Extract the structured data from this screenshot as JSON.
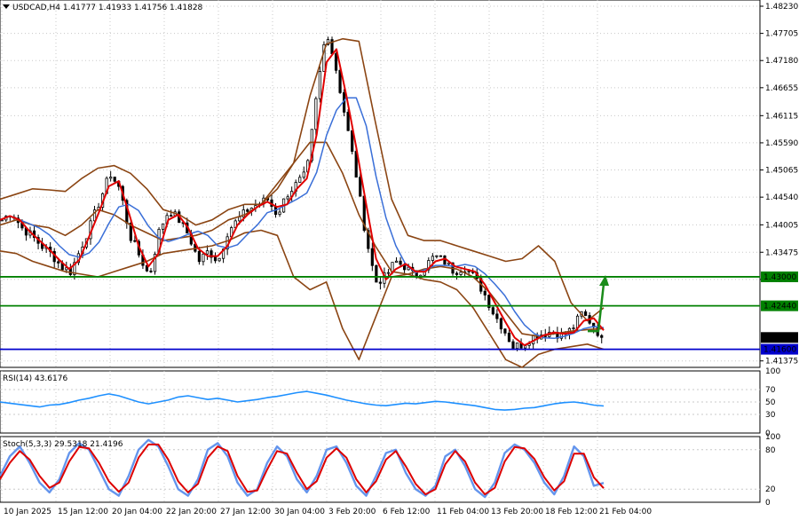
{
  "header": {
    "symbol": "USDCAD,H4",
    "ohlc": "1.41777 1.41933 1.41756 1.41828",
    "menu_icon": "triangle-down-icon"
  },
  "colors": {
    "background": "#ffffff",
    "grid": "#c8c8c8",
    "candle": "#000000",
    "bollinger": "#8b4513",
    "ma_fast": "#e00000",
    "ma_slow": "#3a6fd8",
    "level_green": "#008000",
    "level_blue": "#0000cc",
    "arrow": "#1a8c1a",
    "rsi": "#1e90ff",
    "stoch_main": "#6495ed",
    "stoch_signal": "#dd0000"
  },
  "chart_data": [
    {
      "type": "candlestick",
      "title": "USDCAD,H4",
      "ylim": [
        1.4125,
        1.4835
      ],
      "y_ticks": [
        "1.48230",
        "1.47705",
        "1.47180",
        "1.46655",
        "1.46115",
        "1.45590",
        "1.45065",
        "1.44540",
        "1.44005",
        "1.43475",
        "1.42950",
        "1.41375"
      ],
      "x_ticks": [
        "10 Jan 2025",
        "15 Jan 12:00",
        "20 Jan 04:00",
        "22 Jan 20:00",
        "27 Jan 12:00",
        "30 Jan 04:00",
        "3 Feb 20:00",
        "6 Feb 12:00",
        "11 Feb 04:00",
        "13 Feb 20:00",
        "18 Feb 12:00",
        "21 Feb 04:00"
      ],
      "close_path": [
        1.441,
        1.4425,
        1.4395,
        1.438,
        1.436,
        1.4345,
        1.432,
        1.431,
        1.4355,
        1.44,
        1.445,
        1.45,
        1.447,
        1.438,
        1.434,
        1.43,
        1.439,
        1.443,
        1.441,
        1.438,
        1.433,
        1.435,
        1.433,
        1.439,
        1.441,
        1.443,
        1.444,
        1.445,
        1.442,
        1.446,
        1.448,
        1.45,
        1.465,
        1.478,
        1.47,
        1.46,
        1.45,
        1.438,
        1.429,
        1.43,
        1.433,
        1.432,
        1.43,
        1.432,
        1.434,
        1.433,
        1.431,
        1.432,
        1.43,
        1.427,
        1.423,
        1.42,
        1.4165,
        1.417,
        1.4185,
        1.419,
        1.4195,
        1.4185,
        1.42,
        1.423,
        1.421,
        1.4183
      ],
      "bollinger_upper": [
        1.445,
        1.446,
        1.447,
        1.4468,
        1.4465,
        1.449,
        1.451,
        1.4515,
        1.45,
        1.447,
        1.443,
        1.442,
        1.44,
        1.441,
        1.443,
        1.444,
        1.444,
        1.447,
        1.452,
        1.465,
        1.475,
        1.476,
        1.4755,
        1.46,
        1.445,
        1.438,
        1.437,
        1.437,
        1.436,
        1.435,
        1.434,
        1.433,
        1.4335,
        1.436,
        1.433,
        1.425,
        1.4215,
        1.424
      ],
      "bollinger_mid": [
        1.44,
        1.441,
        1.44,
        1.4395,
        1.438,
        1.44,
        1.443,
        1.442,
        1.44,
        1.4385,
        1.437,
        1.4375,
        1.438,
        1.439,
        1.441,
        1.442,
        1.444,
        1.448,
        1.452,
        1.456,
        1.456,
        1.45,
        1.442,
        1.436,
        1.431,
        1.4305,
        1.4315,
        1.432,
        1.4315,
        1.43,
        1.427,
        1.423,
        1.419,
        1.4185,
        1.419,
        1.4195,
        1.4198,
        1.42
      ],
      "bollinger_lower": [
        1.435,
        1.4345,
        1.433,
        1.432,
        1.431,
        1.4305,
        1.43,
        1.431,
        1.432,
        1.433,
        1.4345,
        1.435,
        1.4355,
        1.436,
        1.437,
        1.4385,
        1.439,
        1.438,
        1.43,
        1.4275,
        1.429,
        1.42,
        1.414,
        1.422,
        1.43,
        1.4305,
        1.4295,
        1.429,
        1.4275,
        1.424,
        1.419,
        1.414,
        1.4125,
        1.415,
        1.416,
        1.4165,
        1.417,
        1.416
      ],
      "levels": [
        {
          "label": "1.43000",
          "value": 1.43
        },
        {
          "label": "1.42440",
          "value": 1.4244
        },
        {
          "label": "1.41828",
          "value": 1.41828
        },
        {
          "label": "1.41600",
          "value": 1.416
        }
      ],
      "arrow": {
        "from": 1.4195,
        "to": 1.43,
        "direction": "up"
      }
    },
    {
      "type": "line",
      "title": "RSI(14) 43.6176",
      "ylim": [
        0,
        100
      ],
      "y_ticks": [
        "100",
        "70",
        "50",
        "30",
        "0"
      ],
      "values": [
        50,
        48,
        46,
        44,
        42,
        45,
        46,
        49,
        53,
        56,
        60,
        63,
        60,
        55,
        50,
        47,
        50,
        53,
        58,
        60,
        57,
        54,
        56,
        53,
        50,
        52,
        54,
        57,
        59,
        62,
        65,
        67,
        64,
        61,
        57,
        53,
        50,
        47,
        45,
        44,
        46,
        48,
        47,
        49,
        51,
        50,
        48,
        46,
        44,
        41,
        38,
        37,
        38,
        40,
        41,
        44,
        47,
        49,
        50,
        48,
        45,
        43.6
      ]
    },
    {
      "type": "line",
      "title": "Stoch(5,3,3) 29.5318 21.4196",
      "ylim": [
        0,
        100
      ],
      "y_ticks": [
        "100",
        "80",
        "20",
        "0"
      ],
      "series": [
        {
          "values": [
            40,
            70,
            85,
            60,
            30,
            15,
            35,
            75,
            90,
            80,
            50,
            20,
            10,
            40,
            80,
            95,
            85,
            55,
            20,
            10,
            35,
            80,
            90,
            70,
            30,
            10,
            20,
            60,
            85,
            70,
            35,
            15,
            40,
            80,
            85,
            60,
            25,
            10,
            40,
            75,
            80,
            45,
            20,
            10,
            25,
            70,
            80,
            55,
            20,
            8,
            30,
            75,
            88,
            80,
            60,
            30,
            12,
            40,
            85,
            70,
            25,
            29.5
          ]
        },
        {
          "values": [
            35,
            60,
            78,
            65,
            40,
            22,
            30,
            62,
            84,
            82,
            60,
            32,
            16,
            30,
            68,
            88,
            88,
            65,
            32,
            15,
            28,
            68,
            85,
            78,
            40,
            16,
            18,
            50,
            78,
            74,
            45,
            20,
            32,
            68,
            82,
            68,
            35,
            15,
            32,
            65,
            78,
            55,
            28,
            12,
            20,
            58,
            78,
            62,
            30,
            12,
            22,
            62,
            84,
            82,
            66,
            38,
            18,
            32,
            74,
            74,
            38,
            21.4
          ]
        }
      ]
    }
  ]
}
